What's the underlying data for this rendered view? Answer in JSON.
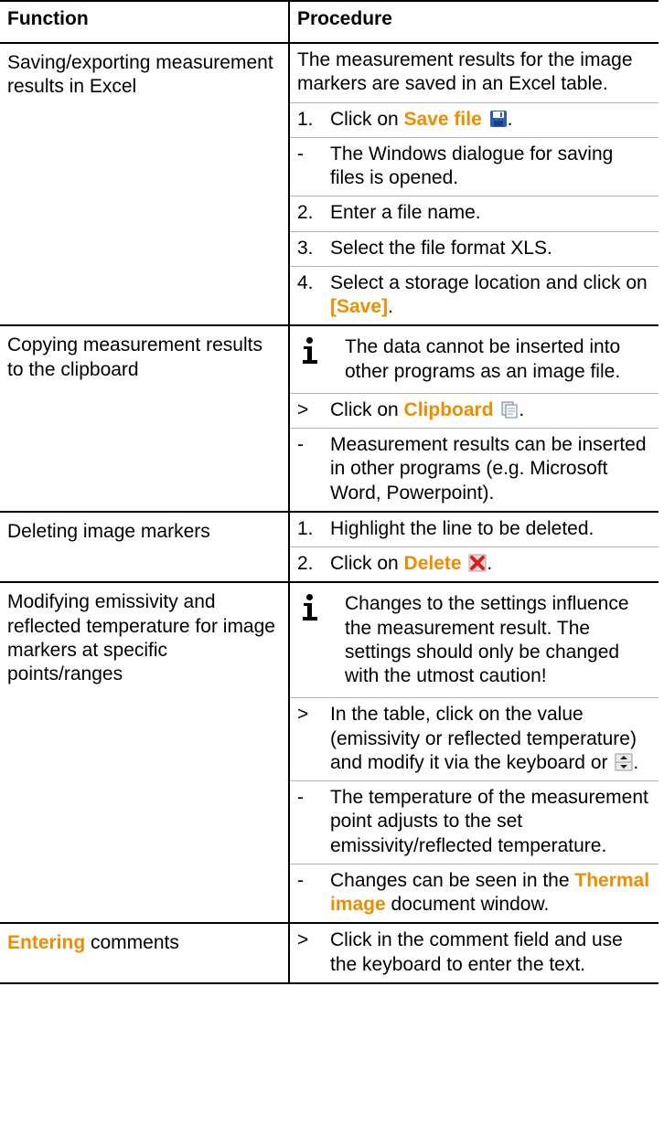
{
  "header": {
    "function": "Function",
    "procedure": "Procedure"
  },
  "rows": {
    "saving": {
      "function": "Saving/exporting measurement results in Excel",
      "intro": "The measurement results for the image markers are saved in an Excel table.",
      "step1_num": "1.",
      "step1_pre": "Click on ",
      "step1_hl": "Save file",
      "step1_post": ".",
      "sub1_mk": "-",
      "sub1": "The Windows dialogue for saving files is opened.",
      "step2_num": "2.",
      "step2": "Enter a file name.",
      "step3_num": "3.",
      "step3": "Select the file format XLS.",
      "step4_num": "4.",
      "step4_pre": "Select a storage location and click on ",
      "step4_hl": "[Save]",
      "step4_post": "."
    },
    "copying": {
      "function": "Copying measurement results to the clipboard",
      "note": "The data cannot be inserted into other programs as an image file.",
      "step_mk": ">",
      "step_pre": "Click on ",
      "step_hl": "Clipboard",
      "step_post": ".",
      "sub_mk": "-",
      "sub": "Measurement results can be inserted in other programs (e.g. Microsoft Word, Powerpoint)."
    },
    "deleting": {
      "function": "Deleting image markers",
      "step1_num": "1.",
      "step1": "Highlight the line to be deleted.",
      "step2_num": "2.",
      "step2_pre": "Click on ",
      "step2_hl": "Delete",
      "step2_post": "."
    },
    "modifying": {
      "function": "Modifying emissivity and reflected temperature for image markers at specific points/ranges",
      "note": "Changes to the settings influence the measurement result. The settings should only be changed with the utmost caution!",
      "step_mk": ">",
      "step_pre": "In the table, click on the value (emissivity or reflected temperature) and modify it via the keyboard or ",
      "step_post": ".",
      "sub1_mk": "-",
      "sub1": "The temperature of the measurement point adjusts to the set emissivity/reflected temperature.",
      "sub2_mk": "-",
      "sub2_pre": "Changes can be seen in the ",
      "sub2_hl": "Thermal image",
      "sub2_post": " document window."
    },
    "entering": {
      "function_hl": "Entering",
      "function_post": " comments",
      "step_mk": ">",
      "step": "Click in the comment field and use the keyboard to enter the text."
    }
  },
  "icons": {
    "info": "info-icon",
    "save": "floppy-disk-icon",
    "clipboard": "clipboard-icon",
    "delete": "red-x-icon",
    "spinner": "spin-arrows-icon"
  },
  "colors": {
    "highlight": "#f08c00",
    "border": "#000000",
    "sub_border": "#b5b5b5"
  }
}
